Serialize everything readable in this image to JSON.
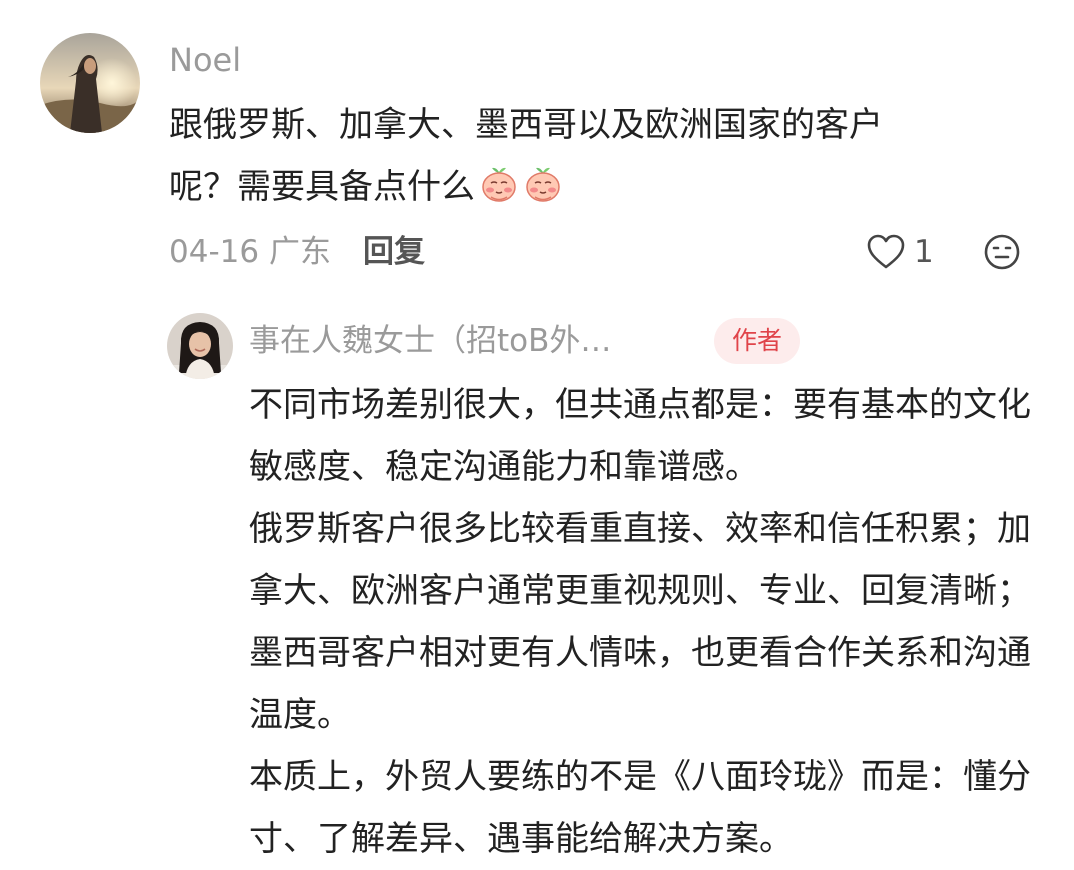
{
  "comment": {
    "username": "Noel",
    "text_lines": [
      "跟俄罗斯、加拿大、墨西哥以及欧洲国家的客户",
      "呢？需要具备点什么"
    ],
    "emoji_icons": [
      "peach-face-emoji",
      "peach-face-emoji"
    ],
    "date": "04-16",
    "location": "广东",
    "reply_label": "回复",
    "like_count": "1"
  },
  "reply": {
    "username": "事在人魏女士（招toB外…",
    "author_badge": "作者",
    "paragraphs": [
      "不同市场差别很大，但共通点都是：要有基本的文化敏感度、稳定沟通能力和靠谱感。",
      "俄罗斯客户很多比较看重直接、效率和信任积累；加拿大、欧洲客户通常更重视规则、专业、回复清晰；墨西哥客户相对更有人情味，也更看合作关系和沟通温度。",
      "本质上，外贸人要练的不是《八面玲珑》而是：懂分寸、了解差异、遇事能给解决方案。"
    ]
  },
  "colors": {
    "text_primary": "#222222",
    "text_secondary": "#9a9a9a",
    "badge_bg": "#fdecec",
    "badge_text": "#e0444a"
  }
}
